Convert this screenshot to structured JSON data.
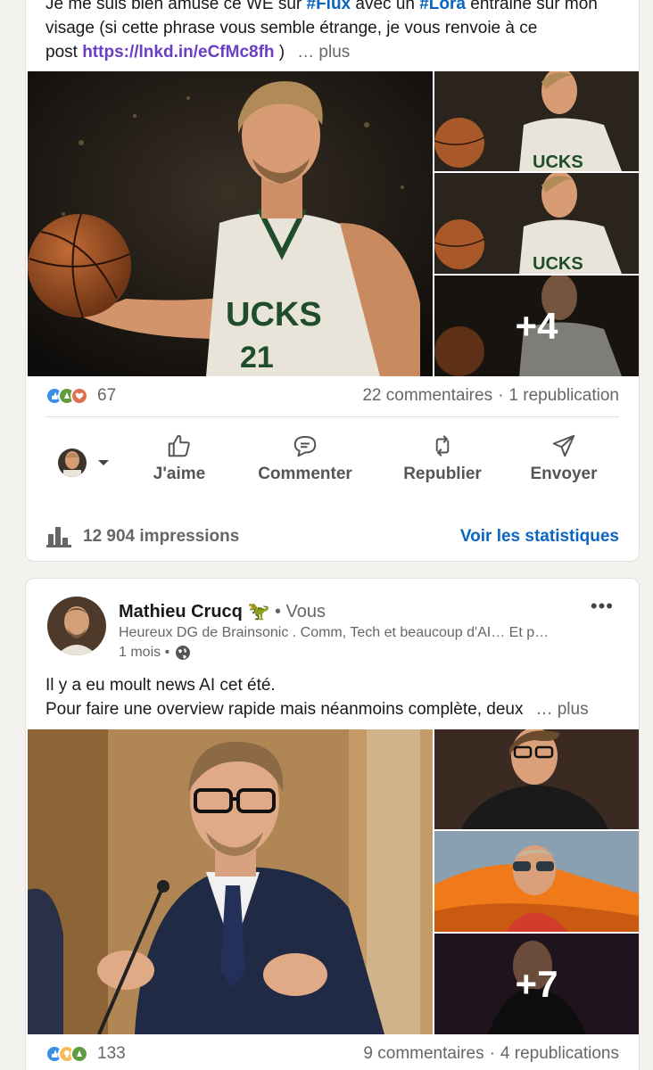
{
  "post1": {
    "text_line1": "Je me suis bien amusé ce WE sur ",
    "hashtag1": "#Flux",
    "text_mid": " avec un ",
    "hashtag2": "#Lora",
    "text_after": " entrainé sur mon",
    "text_line2": "visage (si cette phrase vous semble étrange, je vous renvoie à ce",
    "text_line3_prefix": "post ",
    "link": "https://lnkd.in/eCfMc8fh",
    "link_suffix": " )",
    "more": "… plus",
    "extra_images": "+4",
    "reaction_count": "67",
    "comments": "22 commentaires",
    "reposts": "1 republication",
    "separator": "·",
    "actions": {
      "like": "J'aime",
      "comment": "Commenter",
      "repost": "Republier",
      "send": "Envoyer"
    },
    "impressions": "12 904 impressions",
    "stats_link": "Voir les statistiques"
  },
  "post2": {
    "author_name": "Mathieu Crucq",
    "author_emoji": "🦖",
    "you": "• Vous",
    "headline": "Heureux DG de Brainsonic . Comm, Tech et beaucoup d'AI… Et p…",
    "time": "1 mois •",
    "menu": "•••",
    "text_line1": "Il y a eu moult news AI cet été.",
    "text_line2": "Pour faire une overview rapide mais néanmoins complète, deux",
    "more": "… plus",
    "extra_images": "+7",
    "reaction_count": "133",
    "comments": "9 commentaires",
    "reposts": "4 republications",
    "separator": "·"
  },
  "colors": {
    "link_blue": "#0a66c2",
    "link_purple": "#6a3fc4",
    "like_blue": "#378fe9",
    "celebrate_green": "#5f9b41",
    "love_red": "#df704d",
    "insight_yellow": "#f5bb5c"
  },
  "icons": [
    "like-icon",
    "comment-icon",
    "repost-icon",
    "send-icon",
    "analytics-icon",
    "globe-icon",
    "chevron-down-icon",
    "more-icon"
  ]
}
